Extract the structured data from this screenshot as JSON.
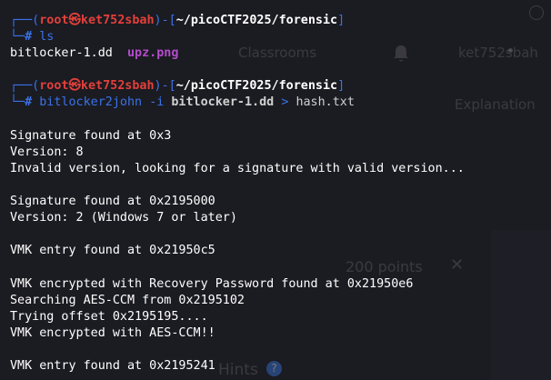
{
  "background": {
    "classrooms": "Classrooms",
    "username": "ket752sbah",
    "points": "200 points",
    "hints": "Hints",
    "partial_1": "8",
    "partial_2": "Explanation"
  },
  "prompt": {
    "open": "┌──(",
    "user": "root㉿ket752sbah",
    "mid": ")-[",
    "path": "~/picoCTF2025/forensic",
    "close": "]",
    "branch": "└─",
    "symbol": "#"
  },
  "commands": [
    {
      "cmd": "ls"
    },
    {
      "cmd": "bitlocker2john",
      "flag": "-i",
      "file": "bitlocker-1.dd",
      "redirect": ">",
      "outfile": "hash.txt"
    }
  ],
  "ls_output": {
    "file1": "bitlocker-1.dd",
    "file2": "upz.png"
  },
  "output_lines": [
    "Signature found at 0x3",
    "Version: 8",
    "Invalid version, looking for a signature with valid version...",
    "",
    "Signature found at 0x2195000",
    "Version: 2 (Windows 7 or later)",
    "",
    "VMK entry found at 0x21950c5",
    "",
    "VMK encrypted with Recovery Password found at 0x21950e6",
    "Searching AES-CCM from 0x2195102",
    "Trying offset 0x2195195....",
    "VMK encrypted with AES-CCM!!",
    "",
    "VMK entry found at 0x2195241"
  ],
  "colors": {
    "background": "#1b1b22",
    "frame_blue": "#3a73e8",
    "user_red": "#e2403a",
    "png_purple": "#b34ccb"
  }
}
